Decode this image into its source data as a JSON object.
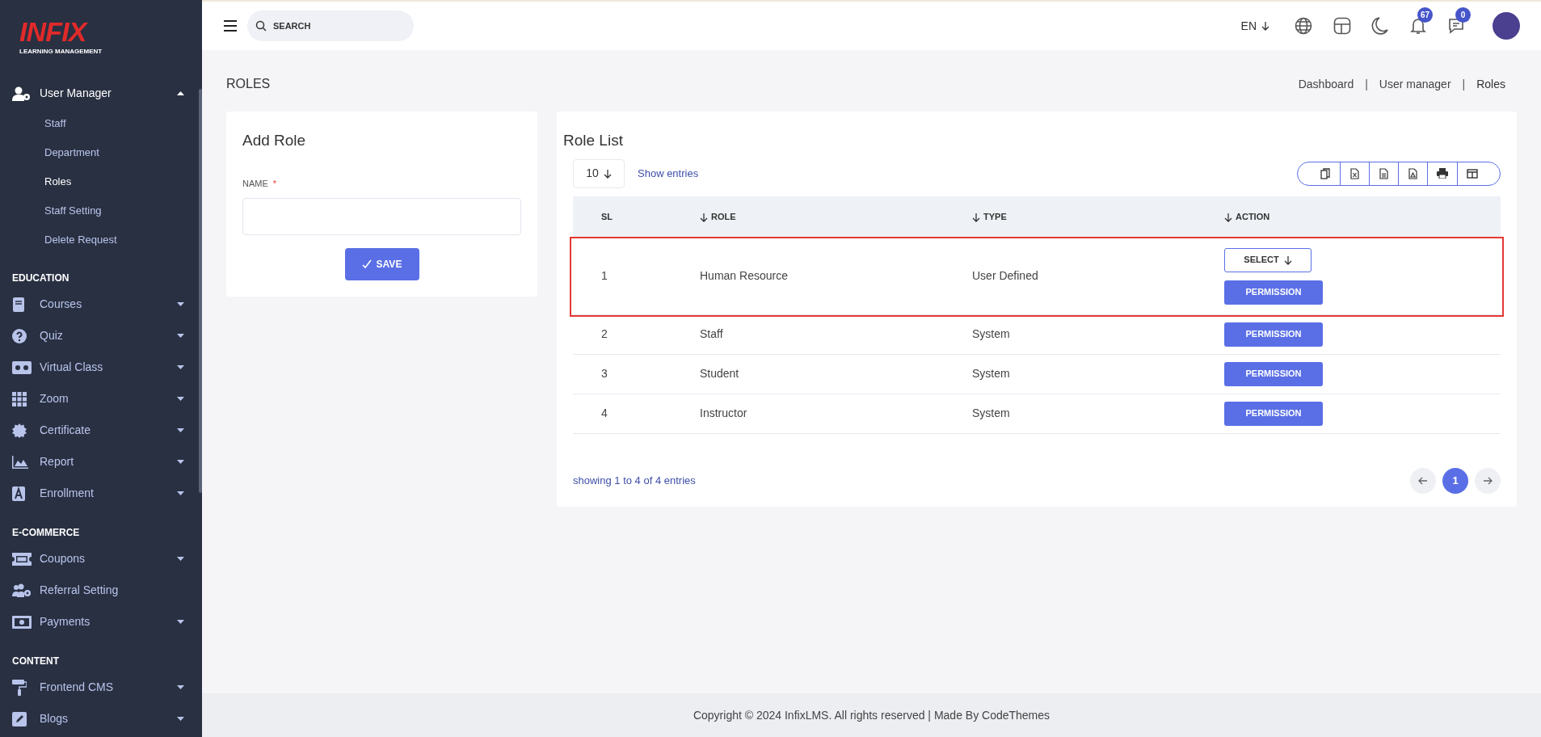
{
  "logo": {
    "mark": "INFIX",
    "tagline": "LEARNING MANAGEMENT"
  },
  "sidebar": {
    "sections": [
      {
        "items": [
          {
            "label": "User Manager",
            "expanded": true,
            "children": [
              {
                "label": "Staff",
                "selected": false
              },
              {
                "label": "Department",
                "selected": false
              },
              {
                "label": "Roles",
                "selected": true
              },
              {
                "label": "Staff Setting",
                "selected": false
              },
              {
                "label": "Delete Request",
                "selected": false
              }
            ]
          }
        ]
      },
      {
        "heading": "EDUCATION",
        "items": [
          {
            "label": "Courses",
            "expanded": false
          },
          {
            "label": "Quiz",
            "expanded": false
          },
          {
            "label": "Virtual Class",
            "expanded": false
          },
          {
            "label": "Zoom",
            "expanded": false
          },
          {
            "label": "Certificate",
            "expanded": false
          },
          {
            "label": "Report",
            "expanded": false
          },
          {
            "label": "Enrollment",
            "expanded": false
          }
        ]
      },
      {
        "heading": "E-COMMERCE",
        "items": [
          {
            "label": "Coupons",
            "expanded": false
          },
          {
            "label": "Referral Setting"
          },
          {
            "label": "Payments",
            "expanded": false
          }
        ]
      },
      {
        "heading": "CONTENT",
        "items": [
          {
            "label": "Frontend CMS",
            "expanded": false
          },
          {
            "label": "Blogs",
            "expanded": false
          }
        ]
      }
    ]
  },
  "header": {
    "search": {
      "placeholder": "SEARCH"
    },
    "language": "EN",
    "notifications": "67",
    "messages": "0"
  },
  "page_title": "ROLES",
  "breadcrumb": {
    "separator": "|",
    "items": [
      "Dashboard",
      "User manager",
      "Roles"
    ]
  },
  "add_role": {
    "title": "Add Role",
    "field_label": "NAME",
    "required_mark": "*",
    "save": "SAVE"
  },
  "role_list": {
    "title": "Role List",
    "page_size": "10",
    "show_entries": "Show entries",
    "columns": [
      {
        "label": "SL",
        "sortable": false
      },
      {
        "label": "ROLE",
        "sortable": true
      },
      {
        "label": "TYPE",
        "sortable": true
      },
      {
        "label": "ACTION",
        "sortable": true
      }
    ],
    "rows": [
      {
        "sl": "1",
        "role": "Human Resource",
        "type": "User Defined",
        "highlighted": true,
        "buttons": [
          {
            "kind": "select",
            "label": "SELECT"
          },
          {
            "kind": "permission",
            "label": "PERMISSION"
          }
        ]
      },
      {
        "sl": "2",
        "role": "Staff",
        "type": "System",
        "highlighted": false,
        "buttons": [
          {
            "kind": "permission",
            "label": "PERMISSION"
          }
        ]
      },
      {
        "sl": "3",
        "role": "Student",
        "type": "System",
        "highlighted": false,
        "buttons": [
          {
            "kind": "permission",
            "label": "PERMISSION"
          }
        ]
      },
      {
        "sl": "4",
        "role": "Instructor",
        "type": "System",
        "highlighted": false,
        "buttons": [
          {
            "kind": "permission",
            "label": "PERMISSION"
          }
        ]
      }
    ],
    "summary": "showing 1 to 4 of 4 entries",
    "pages": [
      {
        "label": "1",
        "selected": true
      }
    ]
  },
  "footer": "Copyright © 2024 InfixLMS. All rights reserved | Made By CodeThemes"
}
